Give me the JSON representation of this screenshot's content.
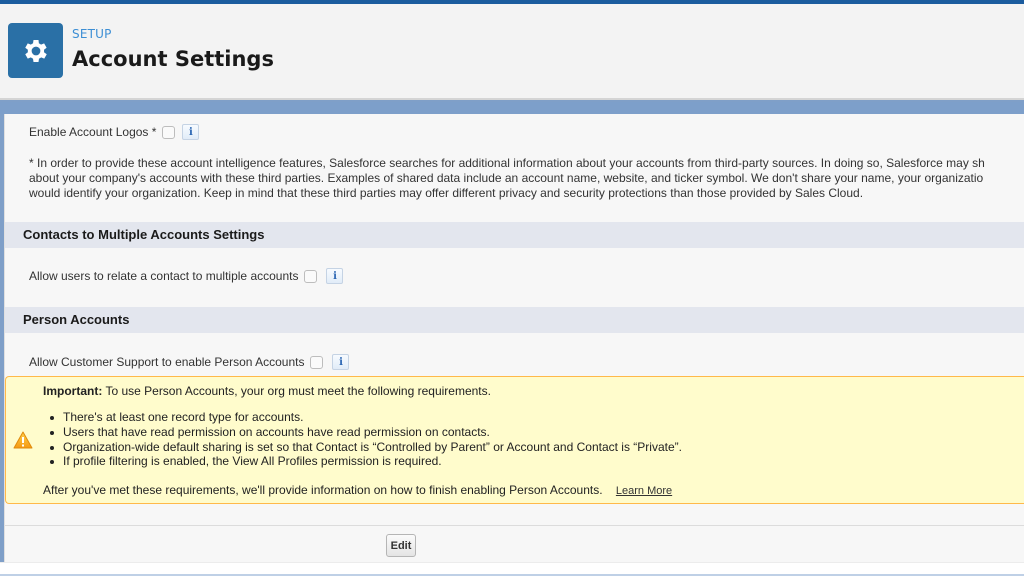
{
  "header": {
    "eyebrow": "SETUP",
    "title": "Account Settings",
    "icon": "gear-icon"
  },
  "account_logos": {
    "label": "Enable Account Logos *",
    "checked": false,
    "info_icon": "i",
    "note_lines": [
      "* In order to provide these account intelligence features, Salesforce searches for additional information about your accounts from third-party sources. In doing so, Salesforce may sh",
      "about your company's accounts with these third parties. Examples of shared data include an account name, website, and ticker symbol. We don't share your name, your organizatio",
      "would identify your organization. Keep in mind that these third parties may offer different privacy and security protections than those provided by Sales Cloud."
    ]
  },
  "contacts_section": {
    "title": "Contacts to Multiple Accounts Settings",
    "field_label": "Allow users to relate a contact to multiple accounts",
    "checked": false,
    "info_icon": "i"
  },
  "person_accounts_section": {
    "title": "Person Accounts",
    "field_label": "Allow Customer Support to enable Person Accounts",
    "checked": false,
    "info_icon": "i"
  },
  "alert": {
    "icon": "warning-icon",
    "lead_bold": "Important:",
    "lead_text": " To use Person Accounts, your org must meet the following requirements.",
    "requirements": [
      "There's at least one record type for accounts.",
      "Users that have read permission on accounts have read permission on contacts.",
      "Organization-wide default sharing is set so that Contact is “Controlled by Parent” or Account and Contact is “Private”.",
      "If profile filtering is enabled, the View All Profiles permission is required."
    ],
    "footer": "After you've met these requirements, we'll provide information on how to finish enabling Person Accounts.",
    "learn_more": "Learn More"
  },
  "actions": {
    "edit_label": "Edit"
  },
  "colors": {
    "brand_blue": "#2a70a6",
    "eyebrow_blue": "#3c8ed4",
    "alert_bg": "#fffccc",
    "alert_border": "#ffb94a",
    "section_bg": "#e3e6ee"
  }
}
